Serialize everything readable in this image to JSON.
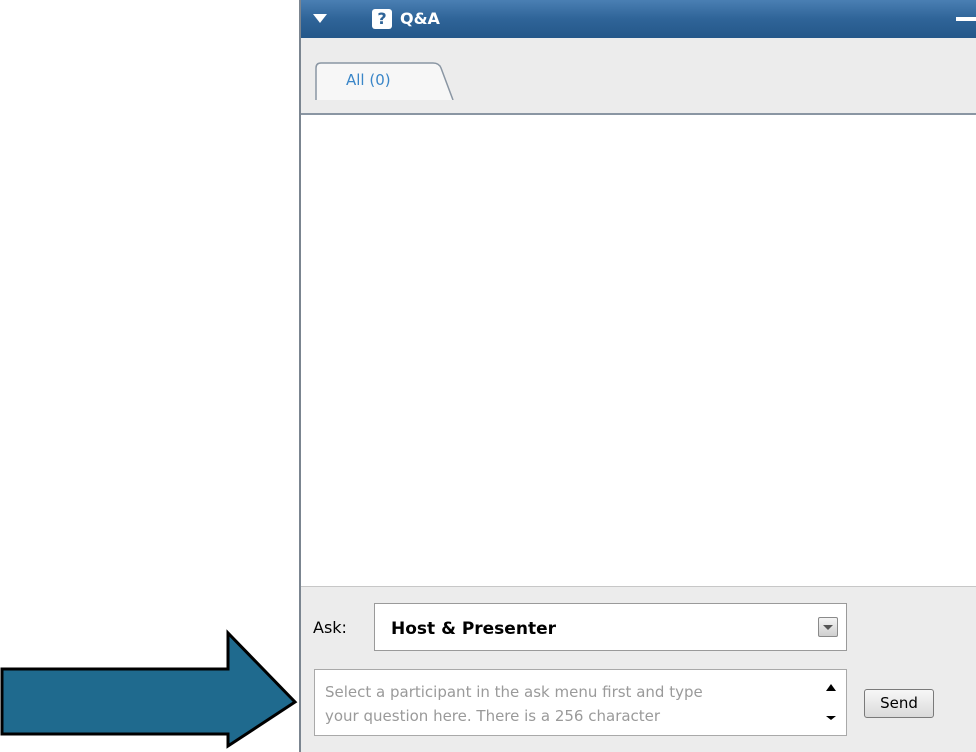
{
  "panel": {
    "title": "Q&A",
    "title_icon": "question-icon",
    "collapse_icon": "triangle-down-icon",
    "minimize_icon": "minimize-icon"
  },
  "tabs": [
    {
      "label": "All (0)",
      "active": true
    }
  ],
  "ask": {
    "label": "Ask:",
    "selected": "Host & Presenter",
    "dropdown_icon": "chevron-down-icon"
  },
  "question": {
    "placeholder_line1": "Select a participant in the ask menu first and type",
    "placeholder_line2": "your question here. There is a 256 character"
  },
  "send": {
    "label": "Send"
  },
  "colors": {
    "titlebar": "#2f6498",
    "tab_text": "#3a86c8",
    "arrow_fill": "#1f6a8e",
    "panel_bg": "#ececec"
  }
}
